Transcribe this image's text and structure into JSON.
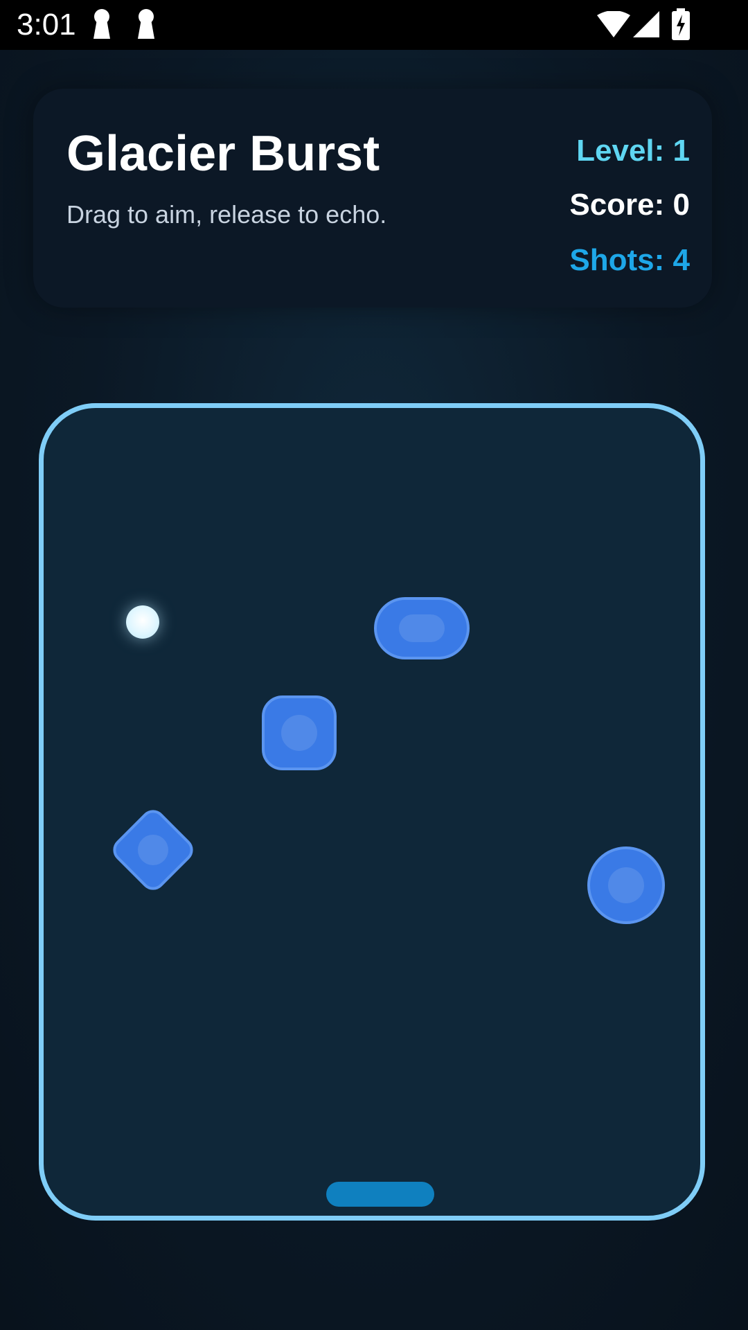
{
  "status_bar": {
    "time": "3:01",
    "icons": [
      "keyhole-icon",
      "keyhole-icon",
      "wifi-icon",
      "cell-signal-icon",
      "battery-charging-icon"
    ]
  },
  "game": {
    "title": "Glacier Burst",
    "subtitle": "Drag to aim, release to echo.",
    "stats": {
      "level": "Level: 1",
      "score": "Score: 0",
      "shots": "Shots: 4"
    }
  },
  "colors": {
    "background": "#0b1825",
    "card": "#0c1826",
    "field_border": "#7fcdf7",
    "field": "#0f2739",
    "block": "#3a7ae6",
    "level_text": "#5fd6f2",
    "shots_text": "#1ea7e8",
    "paddle": "#0f80bf"
  }
}
